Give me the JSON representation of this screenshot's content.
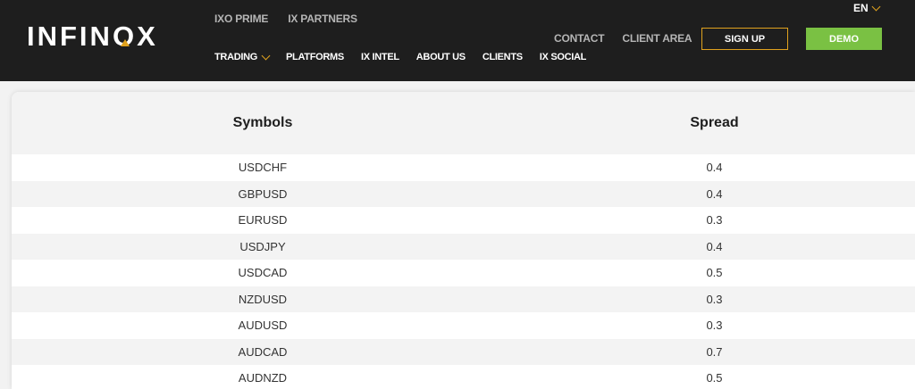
{
  "brand": {
    "logo_prefix": "INFIN",
    "logo_o": "O",
    "logo_suffix": "X",
    "accent_color": "#e0a21e",
    "demo_color": "#7ac143"
  },
  "header": {
    "top_links": [
      "IXO PRIME",
      "IX PARTNERS"
    ],
    "nav": [
      {
        "label": "TRADING",
        "dropdown": true
      },
      {
        "label": "PLATFORMS"
      },
      {
        "label": "IX INTEL"
      },
      {
        "label": "ABOUT US"
      },
      {
        "label": "CLIENTS"
      },
      {
        "label": "IX SOCIAL"
      }
    ],
    "language": "EN",
    "right_links": [
      "CONTACT",
      "CLIENT AREA"
    ],
    "signup_label": "SIGN UP",
    "demo_label": "DEMO"
  },
  "table": {
    "columns": [
      "Symbols",
      "Spread"
    ],
    "rows": [
      [
        "USDCHF",
        "0.4"
      ],
      [
        "GBPUSD",
        "0.4"
      ],
      [
        "EURUSD",
        "0.3"
      ],
      [
        "USDJPY",
        "0.4"
      ],
      [
        "USDCAD",
        "0.5"
      ],
      [
        "NZDUSD",
        "0.3"
      ],
      [
        "AUDUSD",
        "0.3"
      ],
      [
        "AUDCAD",
        "0.7"
      ],
      [
        "AUDNZD",
        "0.5"
      ]
    ]
  }
}
